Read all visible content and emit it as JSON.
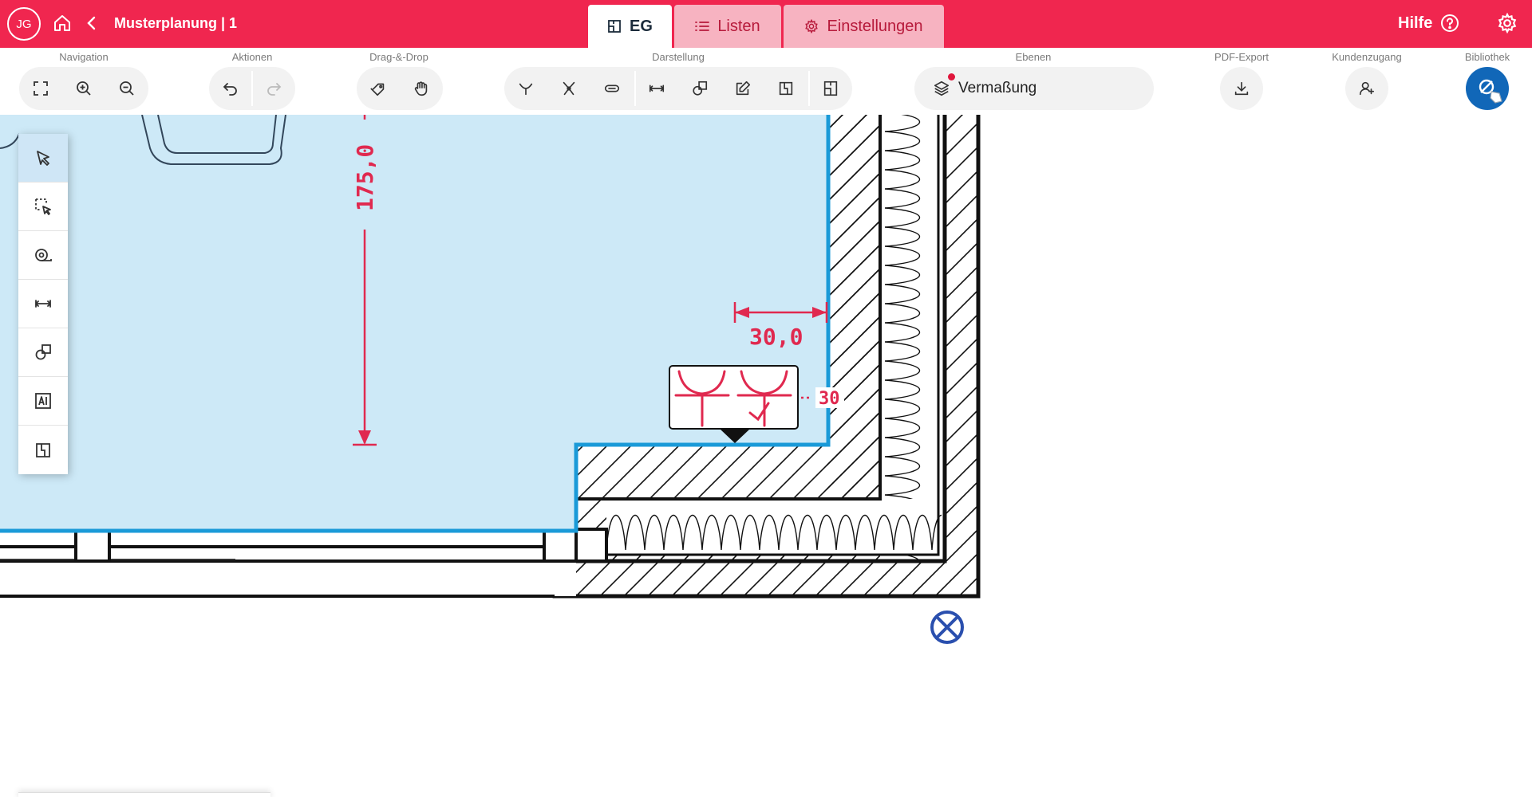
{
  "header": {
    "avatar_initials": "JG",
    "project_title": "Musterplanung | 1",
    "tabs": [
      {
        "label": "EG",
        "icon": "floorplan-icon",
        "active": true
      },
      {
        "label": "Listen",
        "icon": "list-icon",
        "active": false
      },
      {
        "label": "Einstellungen",
        "icon": "gear-icon",
        "active": false
      }
    ],
    "help_label": "Hilfe"
  },
  "toolbar": {
    "groups": {
      "navigation": "Navigation",
      "actions": "Aktionen",
      "dragdrop": "Drag-&-Drop",
      "display": "Darstellung",
      "layers": "Ebenen",
      "pdf": "PDF-Export",
      "customer": "Kundenzugang",
      "library": "Bibliothek"
    },
    "layer_value": "Vermaßung"
  },
  "drawing": {
    "dimension_vertical": "175,0",
    "dimension_horizontal": "30,0",
    "connection_tag": "30"
  },
  "colors": {
    "brand": "#f0264f",
    "tab_inactive": "#f7b3c1",
    "room_fill": "#cde9f7",
    "room_outline": "#1a9ad8",
    "dimension": "#e0294f",
    "library_button": "#1167b8"
  }
}
